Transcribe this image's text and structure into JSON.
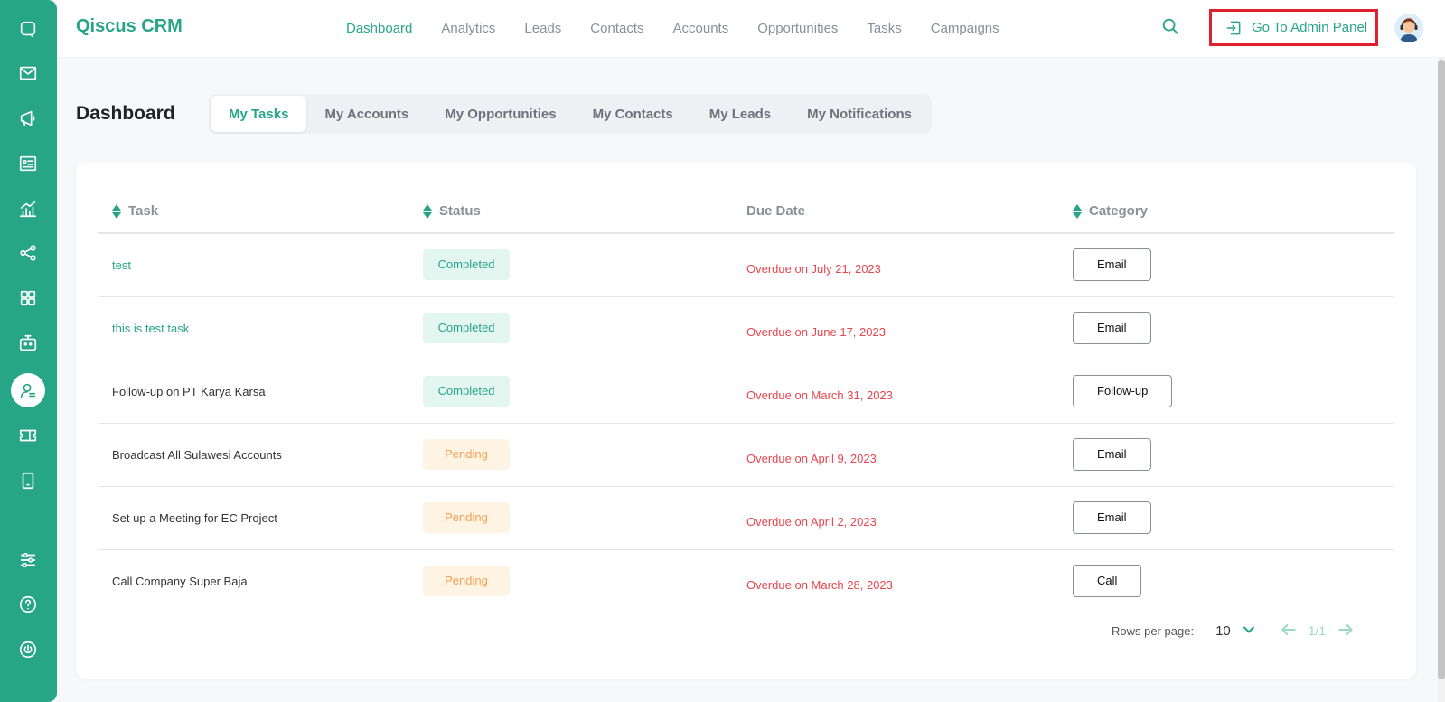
{
  "app": {
    "brand": "Qiscus CRM"
  },
  "rail": {
    "items": [
      "chat-icon",
      "mail-icon",
      "megaphone-icon",
      "id-card-icon",
      "analytics-icon",
      "share-icon",
      "apps-icon",
      "bot-icon",
      "crm-agent-icon",
      "ticket-icon",
      "mobile-icon",
      "settings-sliders-icon",
      "help-icon",
      "power-icon"
    ],
    "active": "crm-agent-icon"
  },
  "nav": {
    "items": [
      "Dashboard",
      "Analytics",
      "Leads",
      "Contacts",
      "Accounts",
      "Opportunities",
      "Tasks",
      "Campaigns"
    ],
    "active": "Dashboard"
  },
  "header": {
    "admin_label": "Go To Admin Panel"
  },
  "page": {
    "title": "Dashboard",
    "tabs": [
      "My Tasks",
      "My Accounts",
      "My Opportunities",
      "My Contacts",
      "My Leads",
      "My Notifications"
    ],
    "active_tab": "My Tasks"
  },
  "table": {
    "headers": {
      "task": "Task",
      "status": "Status",
      "due": "Due Date",
      "category": "Category"
    },
    "rows": [
      {
        "task": "test",
        "link": true,
        "status": "Completed",
        "due": "Overdue on July 21, 2023",
        "category": "Email"
      },
      {
        "task": "this is test task",
        "link": true,
        "status": "Completed",
        "due": "Overdue on June 17, 2023",
        "category": "Email"
      },
      {
        "task": "Follow-up on PT Karya Karsa",
        "link": false,
        "status": "Completed",
        "due": "Overdue on March 31, 2023",
        "category": "Follow-up"
      },
      {
        "task": "Broadcast All Sulawesi Accounts",
        "link": false,
        "status": "Pending",
        "due": "Overdue on April 9, 2023",
        "category": "Email"
      },
      {
        "task": "Set up a Meeting for EC Project",
        "link": false,
        "status": "Pending",
        "due": "Overdue on April 2, 2023",
        "category": "Email"
      },
      {
        "task": "Call Company Super Baja",
        "link": false,
        "status": "Pending",
        "due": "Overdue on March 28, 2023",
        "category": "Call"
      }
    ]
  },
  "pagination": {
    "rows_label": "Rows per page:",
    "rows_value": "10",
    "page_info": "1/1"
  },
  "colors": {
    "accent": "#27a587",
    "overdue": "#e8464e",
    "pending": "#f5a052",
    "highlight_border": "#e0202f"
  }
}
